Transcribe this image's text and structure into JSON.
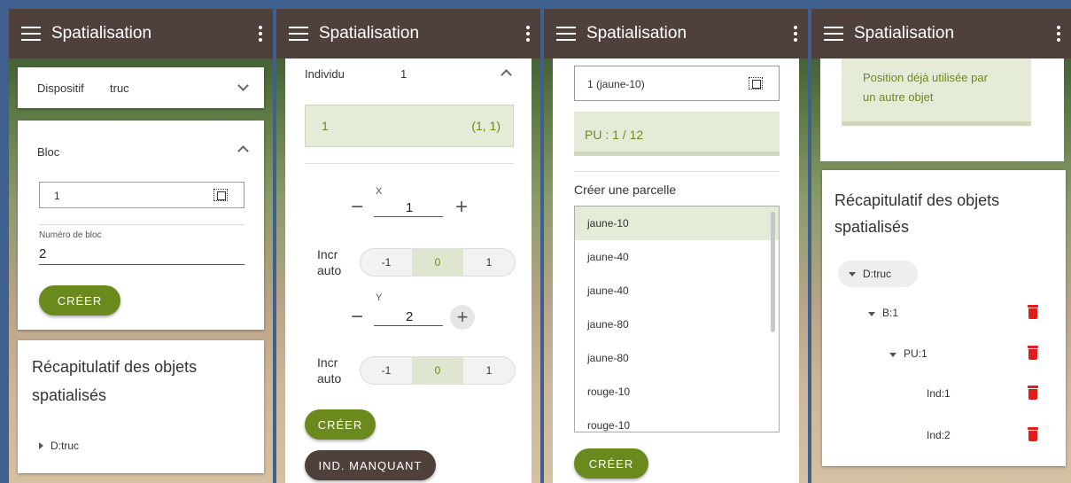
{
  "app": {
    "title": "Spatialisation"
  },
  "p1": {
    "dispositif_label": "Dispositif",
    "dispositif_value": "truc",
    "bloc_title": "Bloc",
    "bloc_select_value": "1",
    "numero_label": "Numéro de bloc",
    "numero_value": "2",
    "create_label": "CRÉER",
    "recap_title_1": "Récapitulatif des objets",
    "recap_title_2": "spatialisés",
    "tree_root": "D:truc"
  },
  "p2": {
    "individu_label": "Individu",
    "individu_value": "1",
    "selected_left": "1",
    "selected_right": "(1, 1)",
    "x_label": "X",
    "x_value": "1",
    "y_label": "Y",
    "y_value": "2",
    "incr_line1": "Incr",
    "incr_line2": "auto",
    "seg_options": [
      "-1",
      "0",
      "1"
    ],
    "create_label": "CRÉER",
    "missing_label": "IND. MANQUANT"
  },
  "p3": {
    "select_value": "1 (jaune-10)",
    "pu_text": "PU : 1 / 12",
    "create_parcel_title": "Créer une parcelle",
    "list": [
      "jaune-10",
      "jaune-40",
      "jaune-40",
      "jaune-80",
      "jaune-80",
      "rouge-10",
      "rouge-10"
    ],
    "create_label": "CRÉER"
  },
  "p4": {
    "warning_1": "Position déjà utilisée par",
    "warning_2": "un autre objet",
    "recap_title_1": "Récapitulatif des objets",
    "recap_title_2": "spatialisés",
    "tree": {
      "d": "D:truc",
      "b": "B:1",
      "pu": "PU:1",
      "ind1": "Ind:1",
      "ind2": "Ind:2"
    }
  },
  "colors": {
    "appbar": "#4f403c",
    "accent": "#6b8a1e",
    "delete": "#e21b1b",
    "selected": "#e4ebd6"
  }
}
